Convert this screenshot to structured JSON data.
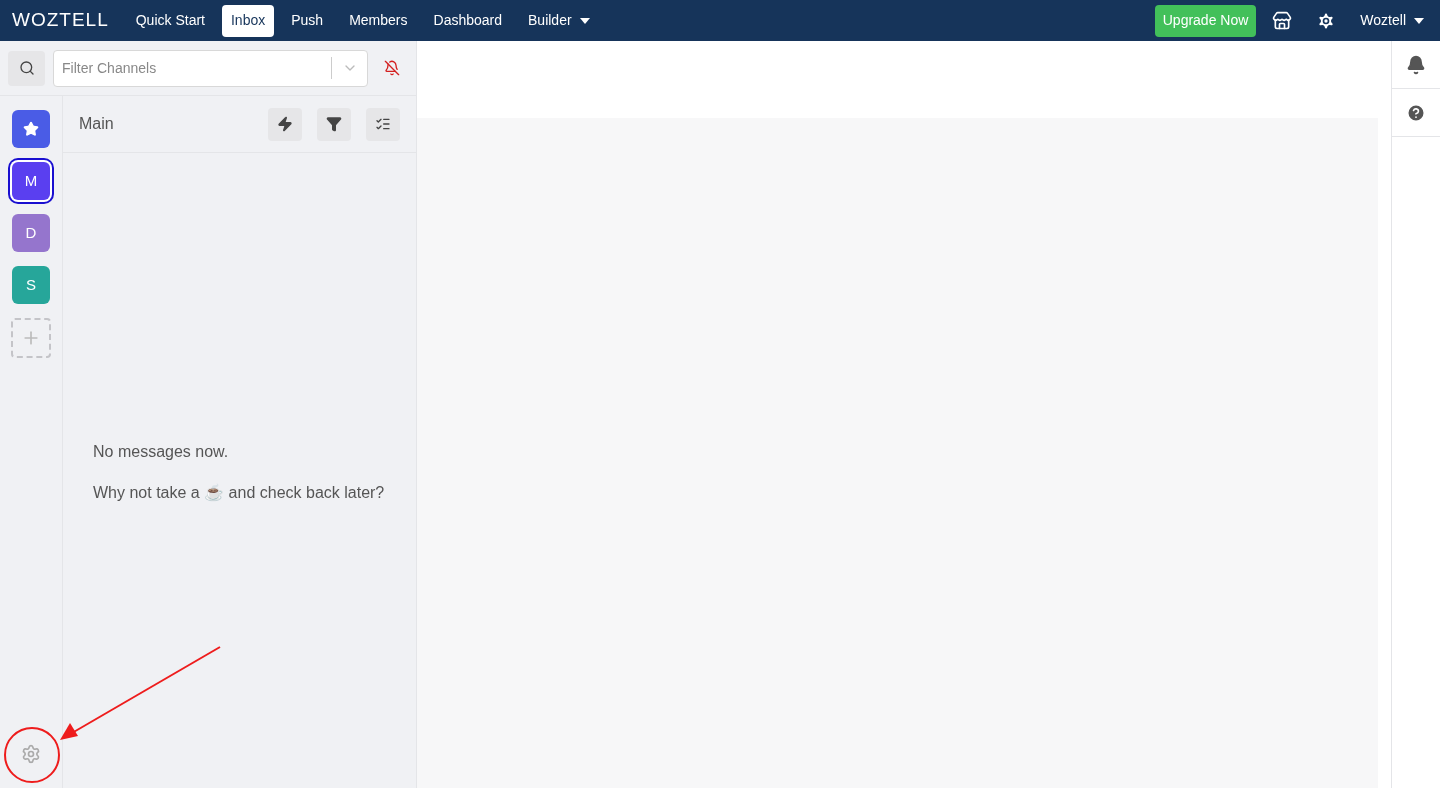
{
  "navbar": {
    "logo": "WOZTELL",
    "tabs": [
      {
        "label": "Quick Start",
        "selected": false
      },
      {
        "label": "Inbox",
        "selected": true
      },
      {
        "label": "Push",
        "selected": false
      },
      {
        "label": "Members",
        "selected": false
      },
      {
        "label": "Dashboard",
        "selected": false
      },
      {
        "label": "Builder",
        "selected": false,
        "dropdown": true
      }
    ],
    "upgrade_button": "Upgrade Now",
    "user": "Woztell"
  },
  "filter": {
    "placeholder": "Filter Channels"
  },
  "channels": [
    {
      "kind": "star",
      "selected": false,
      "color": "#4a5ce6"
    },
    {
      "kind": "letter",
      "label": "M",
      "selected": true,
      "color": "#5a3ff0"
    },
    {
      "kind": "letter",
      "label": "D",
      "selected": false,
      "color": "#9575cd"
    },
    {
      "kind": "letter",
      "label": "S",
      "selected": false,
      "color": "#26a69a"
    },
    {
      "kind": "add"
    }
  ],
  "inbox": {
    "title": "Main",
    "empty_title": "No messages now.",
    "empty_text": "Why not take a ☕ and check back later?"
  }
}
